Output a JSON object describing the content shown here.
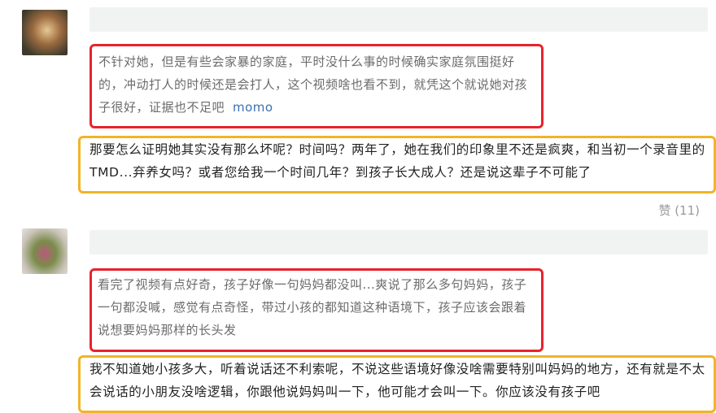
{
  "comments": [
    {
      "quote": "不针对她，但是有些会家暴的家庭，平时没什么事的时候确实家庭氛围挺好的，冲动打人的时候还是会打人，这个视频啥也看不到，就凭这个就说她对孩子很好，证据也不足吧",
      "quote_author": "momo",
      "reply": "那要怎么证明她其实没有那么坏呢？时间吗？两年了，她在我们的印象里不还是疯爽，和当初一个录音里的TMD...弃养女吗？或者您给我一个时间几年？到孩子长大成人？还是说这辈子不可能了",
      "like_label": "赞 (11)"
    },
    {
      "quote": "看完了视频有点好奇，孩子好像一句妈妈都没叫...爽说了那么多句妈妈，孩子一句都没喊，感觉有点奇怪，带过小孩的都知道这种语境下，孩子应该会跟着说想要妈妈那样的长头发",
      "reply": "我不知道她小孩多大，听着说话还不利索呢，不说这些语境好像没啥需要特别叫妈妈的地方，还有就是不太会说话的小朋友没啥逻辑，你跟他说妈妈叫一下，他可能才会叫一下。你应该没有孩子吧"
    }
  ],
  "colors": {
    "highlight_red": "#e8232c",
    "highlight_yellow": "#f0b428",
    "link": "#3c6fb0"
  }
}
